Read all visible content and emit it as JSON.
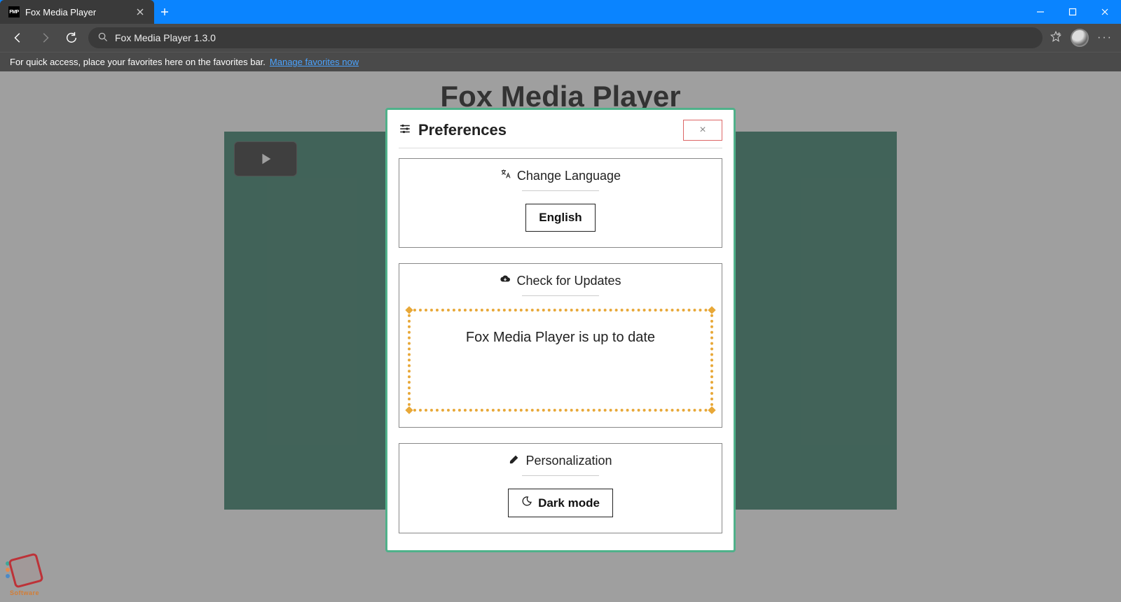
{
  "browser": {
    "tab_title": "Fox Media Player",
    "tab_favicon_text": "FMP",
    "address_text": "Fox Media Player 1.3.0",
    "favorites_hint": "For quick access, place your favorites here on the favorites bar.",
    "manage_favorites": "Manage favorites now"
  },
  "page": {
    "title": "Fox Media Player",
    "ghost_text": "F"
  },
  "modal": {
    "title": "Preferences",
    "close_label": "×",
    "sections": {
      "language": {
        "title": "Change Language",
        "button": "English"
      },
      "updates": {
        "title": "Check for Updates",
        "status": "Fox Media Player is up to date"
      },
      "personalization": {
        "title": "Personalization",
        "button": "Dark mode"
      }
    }
  },
  "watermark": {
    "text": "Software"
  }
}
